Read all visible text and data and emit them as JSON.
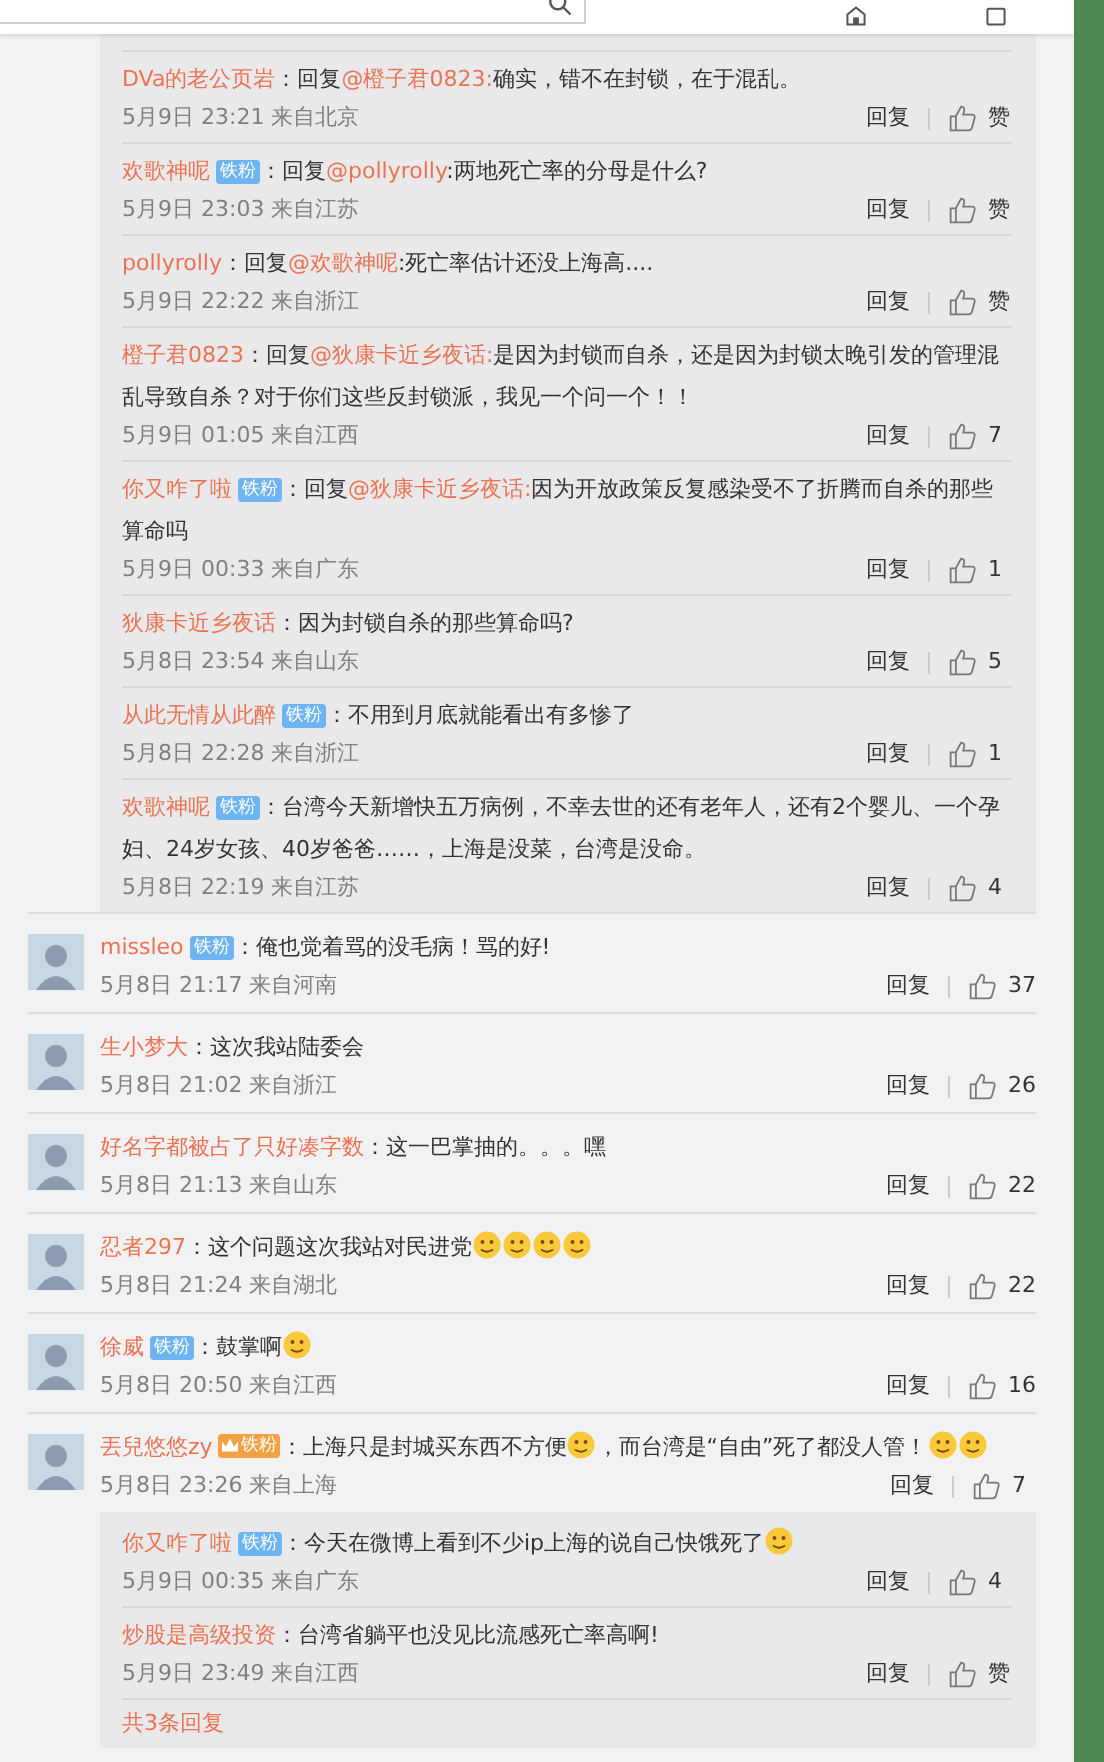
{
  "replies_top": [
    {
      "name": "DVa的老公页岩",
      "content": [
        {
          "kind": "text",
          "text": "：回复"
        },
        {
          "kind": "mention",
          "text": "@橙子君0823:"
        },
        {
          "kind": "text",
          "text": "确实，错不在封锁，在于混乱。"
        }
      ],
      "time": "5月9日 23:21 来自北京",
      "reply": "回复",
      "likes": "赞"
    },
    {
      "name": "欢歌神呢",
      "badge": {
        "kind": "plain",
        "text": "铁粉"
      },
      "content": [
        {
          "kind": "text",
          "text": "：回复"
        },
        {
          "kind": "mention",
          "text": "@pollyrolly"
        },
        {
          "kind": "text",
          "text": ":两地死亡率的分母是什么?"
        }
      ],
      "time": "5月9日 23:03 来自江苏",
      "reply": "回复",
      "likes": "赞"
    },
    {
      "name": "pollyrolly",
      "content": [
        {
          "kind": "text",
          "text": "：回复"
        },
        {
          "kind": "mention",
          "text": "@欢歌神呢"
        },
        {
          "kind": "text",
          "text": ":死亡率估计还没上海高...."
        }
      ],
      "time": "5月9日 22:22 来自浙江",
      "reply": "回复",
      "likes": "赞"
    },
    {
      "name": "橙子君0823",
      "content": [
        {
          "kind": "text",
          "text": "：回复"
        },
        {
          "kind": "mention",
          "text": "@狄康卡近乡夜话:"
        },
        {
          "kind": "text",
          "text": "是因为封锁而自杀，还是因为封锁太晚引发的管理混乱导致自杀？对于你们这些反封锁派，我见一个问一个！！"
        }
      ],
      "time": "5月9日 01:05 来自江西",
      "reply": "回复",
      "likes": "7"
    },
    {
      "name": "你又咋了啦",
      "badge": {
        "kind": "plain",
        "text": "铁粉"
      },
      "content": [
        {
          "kind": "text",
          "text": "：回复"
        },
        {
          "kind": "mention",
          "text": "@狄康卡近乡夜话:"
        },
        {
          "kind": "text",
          "text": "因为开放政策反复感染受不了折腾而自杀的那些算命吗"
        }
      ],
      "time": "5月9日 00:33 来自广东",
      "reply": "回复",
      "likes": "1"
    },
    {
      "name": "狄康卡近乡夜话",
      "content": [
        {
          "kind": "text",
          "text": "：因为封锁自杀的那些算命吗?"
        }
      ],
      "time": "5月8日 23:54 来自山东",
      "reply": "回复",
      "likes": "5"
    },
    {
      "name": "从此无情从此醉",
      "badge": {
        "kind": "plain",
        "text": "铁粉"
      },
      "content": [
        {
          "kind": "text",
          "text": "：不用到月底就能看出有多惨了"
        }
      ],
      "time": "5月8日 22:28 来自浙江",
      "reply": "回复",
      "likes": "1"
    },
    {
      "name": "欢歌神呢",
      "badge": {
        "kind": "plain",
        "text": "铁粉"
      },
      "content": [
        {
          "kind": "text",
          "text": "：台湾今天新增快五万病例，不幸去世的还有老年人，还有2个婴儿、一个孕妇、24岁女孩、40岁爸爸……，上海是没菜，台湾是没命。"
        }
      ],
      "time": "5月8日 22:19 来自江苏",
      "reply": "回复",
      "likes": "4"
    }
  ],
  "comments": [
    {
      "name": "missleo",
      "badge": {
        "kind": "plain",
        "text": "铁粉"
      },
      "content": [
        {
          "kind": "text",
          "text": "：俺也觉着骂的没毛病！骂的好!"
        }
      ],
      "time": "5月8日 21:17 来自河南",
      "reply": "回复",
      "likes": "37"
    },
    {
      "name": "生小梦大",
      "content": [
        {
          "kind": "text",
          "text": "：这次我站陆委会"
        }
      ],
      "time": "5月8日 21:02 来自浙江",
      "reply": "回复",
      "likes": "26"
    },
    {
      "name": "好名字都被占了只好凑字数",
      "content": [
        {
          "kind": "text",
          "text": "：这一巴掌抽的。。。嘿"
        }
      ],
      "time": "5月8日 21:13 来自山东",
      "reply": "回复",
      "likes": "22"
    },
    {
      "name": "忍者297",
      "content": [
        {
          "kind": "text",
          "text": "：这个问题这次我站对民进党"
        },
        {
          "kind": "emoji"
        },
        {
          "kind": "emoji"
        },
        {
          "kind": "emoji"
        },
        {
          "kind": "emoji"
        }
      ],
      "time": "5月8日 21:24 来自湖北",
      "reply": "回复",
      "likes": "22"
    },
    {
      "name": "徐威",
      "badge": {
        "kind": "plain",
        "text": "铁粉"
      },
      "content": [
        {
          "kind": "text",
          "text": "：鼓掌啊"
        },
        {
          "kind": "emoji"
        }
      ],
      "time": "5月8日 20:50 来自江西",
      "reply": "回复",
      "likes": "16"
    },
    {
      "name": "丟兒悠悠zy",
      "badge": {
        "kind": "crown",
        "text": "铁粉"
      },
      "content": [
        {
          "kind": "text",
          "text": "：上海只是封城买东西不方便"
        },
        {
          "kind": "emoji"
        },
        {
          "kind": "text",
          "text": "，而台湾是“自由”死了都没人管！"
        },
        {
          "kind": "emoji"
        },
        {
          "kind": "emoji"
        }
      ],
      "time": "5月8日 23:26 来自上海",
      "reply": "回复",
      "likes": "7",
      "replies": [
        {
          "name": "你又咋了啦",
          "badge": {
            "kind": "plain",
            "text": "铁粉"
          },
          "content": [
            {
              "kind": "text",
              "text": "：今天在微博上看到不少ip上海的说自己快饿死了"
            },
            {
              "kind": "emoji"
            }
          ],
          "time": "5月9日 00:35 来自广东",
          "reply": "回复",
          "likes": "4"
        },
        {
          "name": "炒股是高级投资",
          "content": [
            {
              "kind": "text",
              "text": "：台湾省躺平也没见比流感死亡率高啊!"
            }
          ],
          "time": "5月9日 23:49 来自江西",
          "reply": "回复",
          "likes": "赞"
        }
      ],
      "more": "共3条回复"
    }
  ]
}
